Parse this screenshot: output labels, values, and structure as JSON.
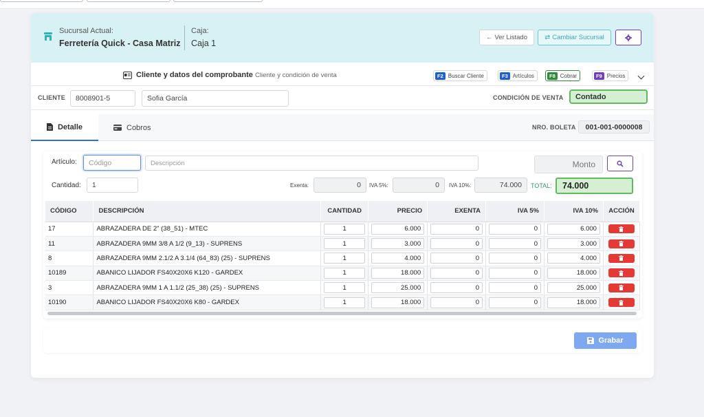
{
  "header": {
    "sucursal_label": "Sucursal Actual:",
    "sucursal_value": "Ferretería Quick - Casa Matriz",
    "caja_label": "Caja:",
    "caja_value": "Caja 1",
    "ver_listado": "Ver Listado",
    "cambiar_sucursal": "Cambiar Sucursal"
  },
  "section": {
    "title": "Cliente y datos del comprobante",
    "subtitle": "Cliente y condición de venta",
    "shortcuts": [
      {
        "key": "F2",
        "label": "Buscar Cliente",
        "color": "#1f5fd0"
      },
      {
        "key": "F3",
        "label": "Artículos",
        "color": "#1f5fd0"
      },
      {
        "key": "F8",
        "label": "Cobrar",
        "color": "#2e8b3a"
      },
      {
        "key": "F9",
        "label": "Precios",
        "color": "#6f3fbf"
      }
    ]
  },
  "client": {
    "label": "CLIENTE",
    "ruc": "8008901-5",
    "name": "Sofia García",
    "condicion_label": "CONDICIÓN DE VENTA",
    "condicion_value": "Contado"
  },
  "tabs": {
    "detalle": "Detalle",
    "cobros": "Cobros",
    "boleta_label": "NRO. BOLETA",
    "boleta_value": "001-001-0000008"
  },
  "entry": {
    "articulo_label": "Artículo:",
    "codigo_placeholder": "Código",
    "descripcion_placeholder": "Descripción",
    "monto_placeholder": "Monto",
    "cantidad_label": "Cantidad:",
    "cantidad_value": "1",
    "exenta_label": "Exenta:",
    "exenta_value": "0",
    "iva5_label": "IVA 5%:",
    "iva5_value": "0",
    "iva10_label": "IVA 10%:",
    "iva10_value": "74.000",
    "total_label": "TOTAL:",
    "total_value": "74.000"
  },
  "table": {
    "headers": [
      "CÓDIGO",
      "DESCRIPCIÓN",
      "CANTIDAD",
      "PRECIO",
      "EXENTA",
      "IVA 5%",
      "IVA 10%",
      "ACCIÓN"
    ],
    "rows": [
      {
        "codigo": "17",
        "descripcion": "ABRAZADERA DE 2\" (38_51) - MTEC",
        "cantidad": "1",
        "precio": "6.000",
        "exenta": "0",
        "iva5": "0",
        "iva10": "6.000"
      },
      {
        "codigo": "11",
        "descripcion": "ABRAZADERA 9MM 3/8 A 1/2 (9_13) - SUPRENS",
        "cantidad": "1",
        "precio": "3.000",
        "exenta": "0",
        "iva5": "0",
        "iva10": "3.000"
      },
      {
        "codigo": "8",
        "descripcion": "ABRAZADERA 9MM 2.1/2 A 3.1/4 (64_83) (25) - SUPRENS",
        "cantidad": "1",
        "precio": "4.000",
        "exenta": "0",
        "iva5": "0",
        "iva10": "4.000"
      },
      {
        "codigo": "10189",
        "descripcion": "ABANICO LIJADOR FS40X20X6 K120 - GARDEX",
        "cantidad": "1",
        "precio": "18.000",
        "exenta": "0",
        "iva5": "0",
        "iva10": "18.000"
      },
      {
        "codigo": "3",
        "descripcion": "ABRAZADERA 9MM 1 A 1.1/2 (25_38) (25) - SUPRENS",
        "cantidad": "1",
        "precio": "25.000",
        "exenta": "0",
        "iva5": "0",
        "iva10": "25.000"
      },
      {
        "codigo": "10190",
        "descripcion": "ABANICO LIJADOR FS40X20X6 K80 - GARDEX",
        "cantidad": "1",
        "precio": "18.000",
        "exenta": "0",
        "iva5": "0",
        "iva10": "18.000"
      }
    ]
  },
  "footer": {
    "grabar": "Grabar"
  },
  "icons": {
    "store": "store-icon",
    "arrow_left": "arrow-left-icon",
    "swap": "swap-icon",
    "gear": "gear-icon",
    "id_card": "id-card-icon",
    "document": "document-icon",
    "credit_card": "credit-card-icon",
    "search": "search-icon",
    "trash": "trash-icon",
    "save": "save-icon"
  }
}
